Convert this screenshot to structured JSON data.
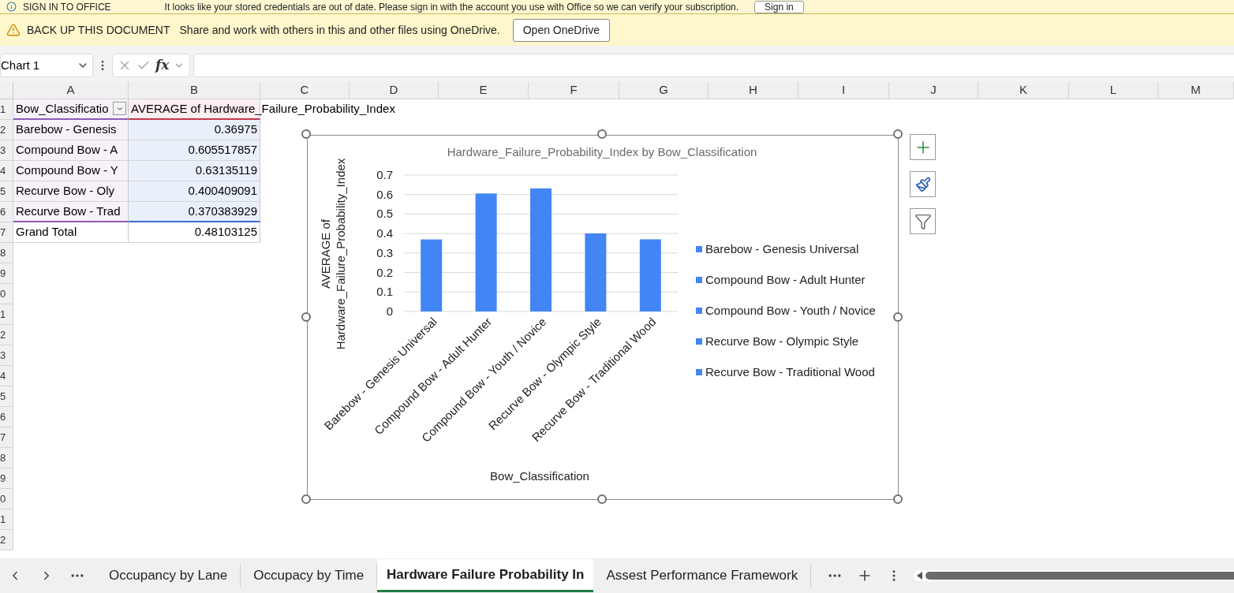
{
  "notifications": [
    {
      "kind": "info",
      "title": "SIGN IN TO OFFICE",
      "message": "It looks like your stored credentials are out of date. Please sign in with the account you use with Office so we can verify your subscription.",
      "button": "Sign in"
    },
    {
      "kind": "warning",
      "title": "BACK UP THIS DOCUMENT",
      "message": "Share and work with others in this and other files using OneDrive.",
      "button": "Open OneDrive"
    }
  ],
  "formula_bar": {
    "name_box": "Chart 1",
    "fx": "fx"
  },
  "columns": [
    "A",
    "B",
    "C",
    "D",
    "E",
    "F",
    "G",
    "H",
    "I",
    "J",
    "K",
    "L",
    "M"
  ],
  "row_numbers": [
    "1",
    "2",
    "3",
    "4",
    "5",
    "6",
    "7",
    "8",
    "9",
    "0",
    "1",
    "2",
    "3",
    "4",
    "5",
    "6",
    "7",
    "8",
    "9",
    "0",
    "1",
    "2"
  ],
  "pivot": {
    "header": [
      "Bow_Classificatio",
      "AVERAGE of Hardware_Failure_Probability_Index"
    ],
    "rows": [
      [
        "Barebow - Genesis",
        "0.36975"
      ],
      [
        "Compound Bow - A",
        "0.605517857"
      ],
      [
        "Compound Bow - Y",
        "0.63135119"
      ],
      [
        "Recurve Bow - Oly",
        "0.400409091"
      ],
      [
        "Recurve Bow - Trad",
        "0.370383929"
      ]
    ],
    "total": [
      "Grand Total",
      "0.48103125"
    ]
  },
  "chart": {
    "chart_data": {
      "type": "bar",
      "title": "Hardware_Failure_Probability_Index by Bow_Classification",
      "xlabel": "Bow_Classification",
      "ylabel": "AVERAGE of Hardware_Failure_Probability_Index",
      "categories": [
        "Barebow - Genesis Universal",
        "Compound Bow - Adult Hunter",
        "Compound Bow - Youth / Novice",
        "Recurve Bow - Olympic Style",
        "Recurve Bow - Traditional Wood"
      ],
      "series": [
        {
          "color": "#4285f4",
          "values": [
            0.36975,
            0.605517857,
            0.63135119,
            0.400409091,
            0.370383929
          ]
        }
      ],
      "ylim": [
        0,
        0.7
      ],
      "grid": true,
      "yticks": [
        0,
        0.1,
        0.2,
        0.3,
        0.4,
        0.5,
        0.6,
        0.7
      ]
    },
    "legend": [
      "Barebow - Genesis Universal",
      "Compound Bow - Adult Hunter",
      "Compound Bow - Youth / Novice",
      "Recurve Bow - Olympic Style",
      "Recurve Bow - Traditional Wood"
    ]
  },
  "sheet_tabs": [
    {
      "label": "Occupancy by Lane",
      "selected": false
    },
    {
      "label": "Occupacy by Time",
      "selected": false
    },
    {
      "label": "Hardware Failure Probability In",
      "selected": true
    },
    {
      "label": "Assest Performance Framework",
      "selected": false
    }
  ]
}
